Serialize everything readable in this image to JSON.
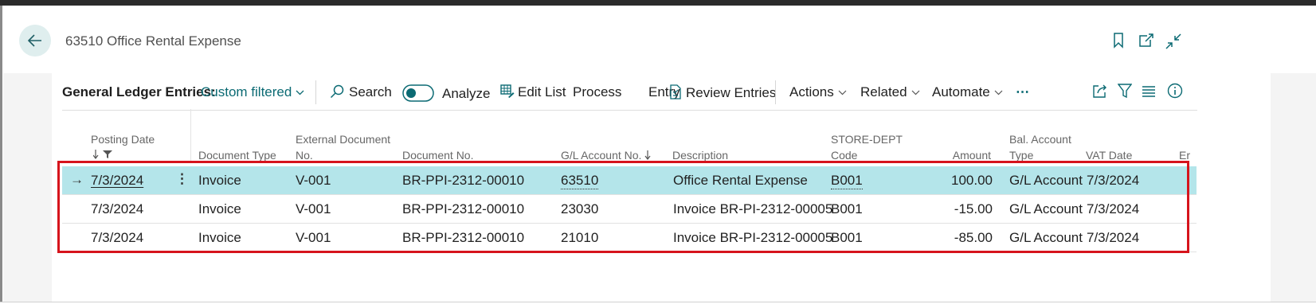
{
  "header": {
    "title": "63510 Office Rental Expense"
  },
  "toolbar": {
    "caption": "General Ledger Entries:",
    "filter_label": "Custom filtered",
    "search": "Search",
    "analyze": "Analyze",
    "edit_list": "Edit List",
    "process": "Process",
    "entry": "Entry",
    "review_entries": "Review Entries",
    "actions": "Actions",
    "related": "Related",
    "automate": "Automate",
    "more": "⋯"
  },
  "columns": {
    "posting_date": "Posting Date",
    "document_type": "Document Type",
    "external_document_no_1": "External Document",
    "external_document_no_2": "No.",
    "document_no": "Document No.",
    "gl_account_no": "G/L Account No.",
    "description": "Description",
    "store_dept_1": "STORE-DEPT",
    "store_dept_2": "Code",
    "amount": "Amount",
    "bal_account_type_1": "Bal. Account",
    "bal_account_type_2": "Type",
    "vat_date": "VAT Date",
    "entry_no_partial": "Er"
  },
  "rows": [
    {
      "posting_date": "7/3/2024",
      "document_type": "Invoice",
      "external_document_no": "V-001",
      "document_no": "BR-PPI-2312-00010",
      "gl_account_no": "63510",
      "description": "Office Rental Expense",
      "store_dept_code": "B001",
      "amount": "100.00",
      "bal_account_type": "G/L Account",
      "vat_date": "7/3/2024"
    },
    {
      "posting_date": "7/3/2024",
      "document_type": "Invoice",
      "external_document_no": "V-001",
      "document_no": "BR-PPI-2312-00010",
      "gl_account_no": "23030",
      "description": "Invoice BR-PI-2312-00005",
      "store_dept_code": "B001",
      "amount": "-15.00",
      "bal_account_type": "G/L Account",
      "vat_date": "7/3/2024"
    },
    {
      "posting_date": "7/3/2024",
      "document_type": "Invoice",
      "external_document_no": "V-001",
      "document_no": "BR-PPI-2312-00010",
      "gl_account_no": "21010",
      "description": "Invoice BR-PI-2312-00005",
      "store_dept_code": "B001",
      "amount": "-85.00",
      "bal_account_type": "G/L Account",
      "vat_date": "7/3/2024"
    }
  ],
  "colors": {
    "accent": "#0b6a73",
    "selected_row": "#b4e5ea",
    "highlight_box": "#d6141c"
  }
}
